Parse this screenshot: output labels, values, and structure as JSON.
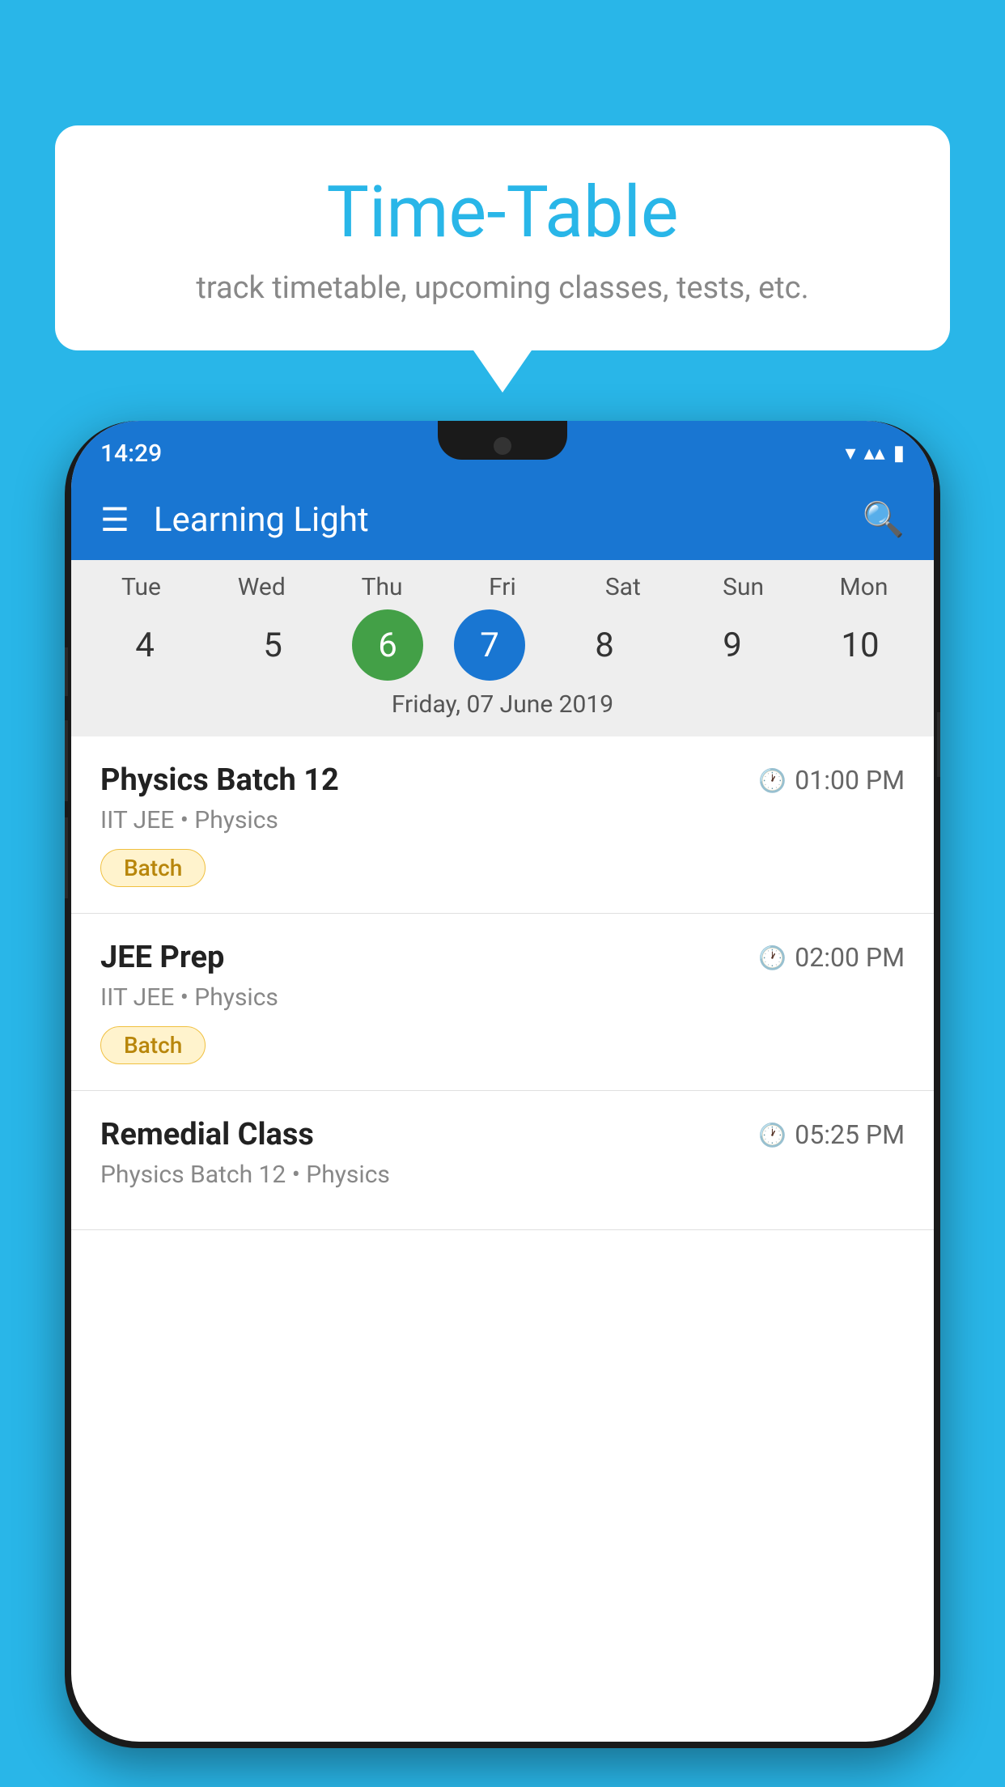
{
  "background_color": "#29B6E8",
  "bubble": {
    "title": "Time-Table",
    "subtitle": "track timetable, upcoming classes, tests, etc."
  },
  "phone": {
    "status_bar": {
      "time": "14:29"
    },
    "app_bar": {
      "title": "Learning Light"
    },
    "calendar": {
      "days": [
        {
          "name": "Tue",
          "num": "4",
          "state": "normal"
        },
        {
          "name": "Wed",
          "num": "5",
          "state": "normal"
        },
        {
          "name": "Thu",
          "num": "6",
          "state": "today"
        },
        {
          "name": "Fri",
          "num": "7",
          "state": "selected"
        },
        {
          "name": "Sat",
          "num": "8",
          "state": "normal"
        },
        {
          "name": "Sun",
          "num": "9",
          "state": "normal"
        },
        {
          "name": "Mon",
          "num": "10",
          "state": "normal"
        }
      ],
      "selected_date": "Friday, 07 June 2019"
    },
    "classes": [
      {
        "name": "Physics Batch 12",
        "time": "01:00 PM",
        "meta": "IIT JEE • Physics",
        "badge": "Batch"
      },
      {
        "name": "JEE Prep",
        "time": "02:00 PM",
        "meta": "IIT JEE • Physics",
        "badge": "Batch"
      },
      {
        "name": "Remedial Class",
        "time": "05:25 PM",
        "meta": "Physics Batch 12 • Physics",
        "badge": null
      }
    ]
  }
}
